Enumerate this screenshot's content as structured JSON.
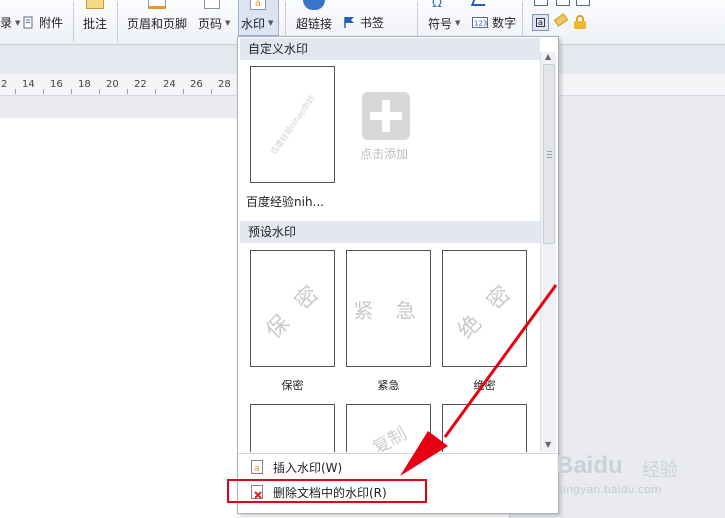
{
  "ribbon": {
    "partial_left": "录",
    "attachment": "附件",
    "comment": "批注",
    "header_footer": "页眉和页脚",
    "page_number": "页码",
    "watermark": "水印",
    "hyperlink": "超链接",
    "bookmark": "书签",
    "symbol": "符号",
    "number": "数字"
  },
  "ruler": {
    "ticks": [
      "2",
      "14",
      "16",
      "18",
      "20",
      "22",
      "24",
      "26",
      "28"
    ]
  },
  "dropdown": {
    "custom_section_title": "自定义水印",
    "custom_thumb_caption": "百度经验nih...",
    "custom_thumb_watermark": "百度经验nihao你好",
    "add_label": "点击添加",
    "preset_section_title": "预设水印",
    "presets": [
      {
        "caption": "保密",
        "mark": "保 密"
      },
      {
        "caption": "紧急",
        "mark": "紧 急"
      },
      {
        "caption": "绝密",
        "mark": "绝 密"
      }
    ],
    "preset_row2_partial_mark": "复制",
    "insert_item": "插入水印(W)",
    "delete_item": "删除文档中的水印(R)"
  },
  "brand": {
    "baidu_main": "Bai",
    "baidu_du": "du",
    "baidu_cn": "经验",
    "baidu_url": "jingyan.baidu.com"
  },
  "colors": {
    "highlight_red": "#e60012",
    "header_band": "#e2e7f0"
  }
}
